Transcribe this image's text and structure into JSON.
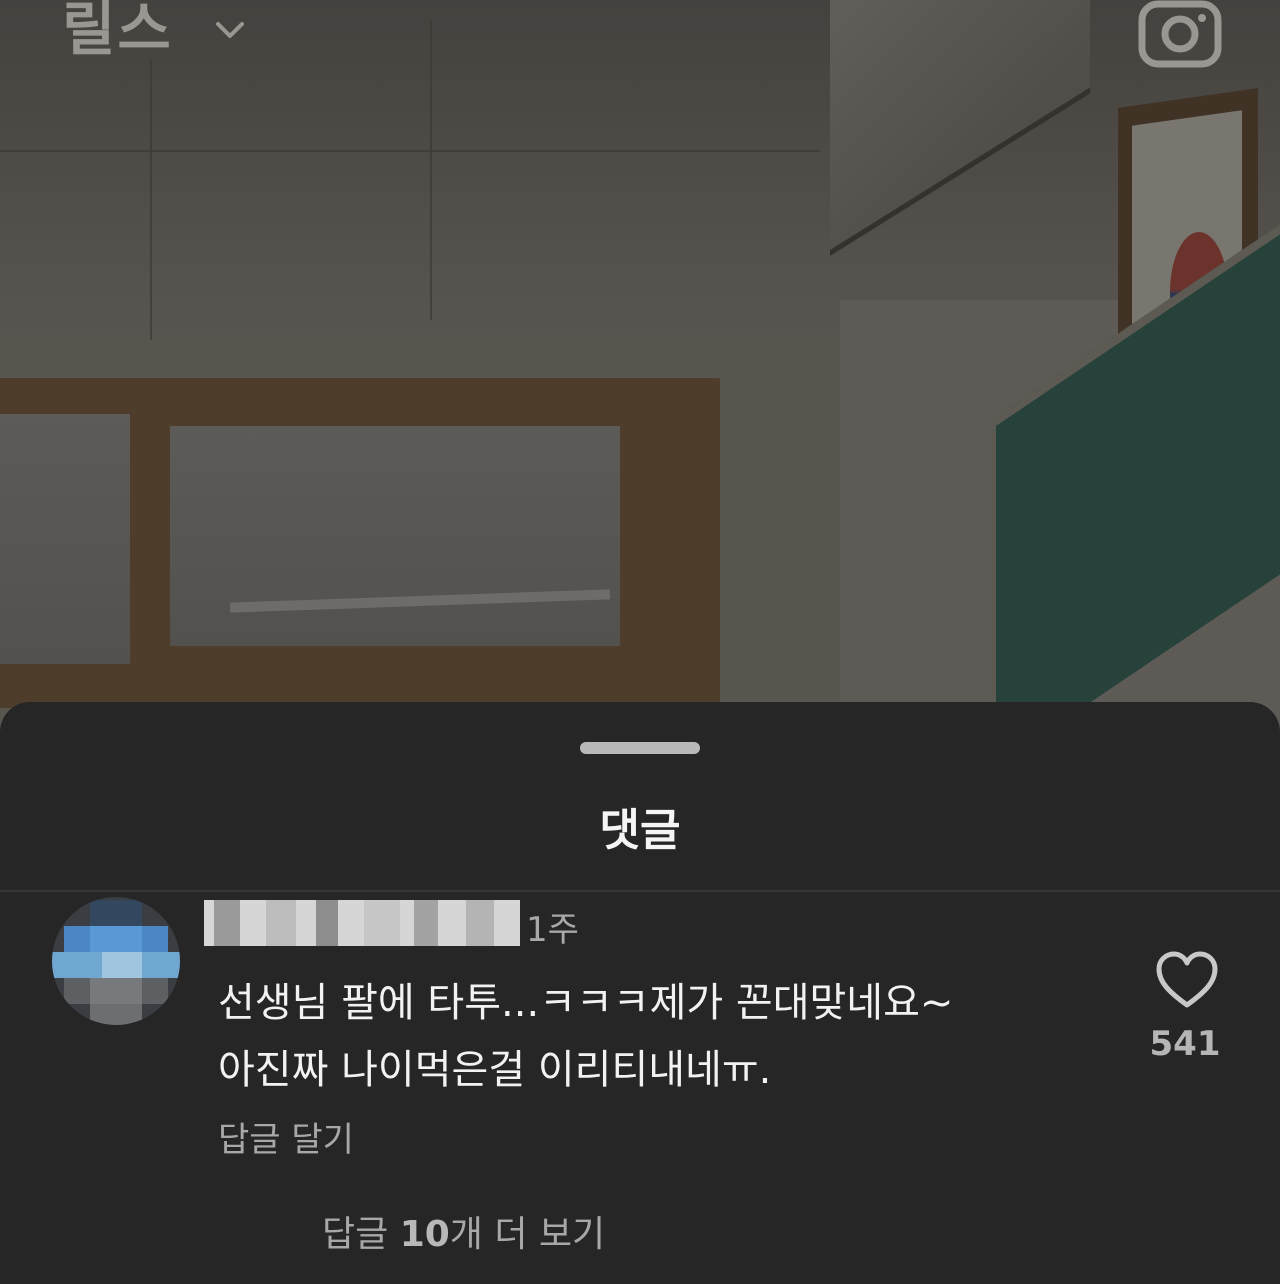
{
  "header": {
    "title": "릴스",
    "chevron_icon": "chevron-down-icon",
    "camera_icon": "camera-icon"
  },
  "sheet": {
    "title": "댓글"
  },
  "comment": {
    "time": "1주",
    "lines": [
      "선생님 팔에 타투...ㅋㅋㅋ제가 꼰대맞네요~",
      "아진짜 나이먹은걸 이리티내네ㅠ."
    ],
    "reply_label": "답글 달기",
    "like_icon": "heart-icon",
    "like_count": "541",
    "view_replies": {
      "prefix": "답글 ",
      "count": "10",
      "suffix": "개 더 보기"
    }
  },
  "colors": {
    "sheet_bg": "#262626",
    "primary_text": "#f2f2f2",
    "secondary_text": "#a8a8a8"
  }
}
